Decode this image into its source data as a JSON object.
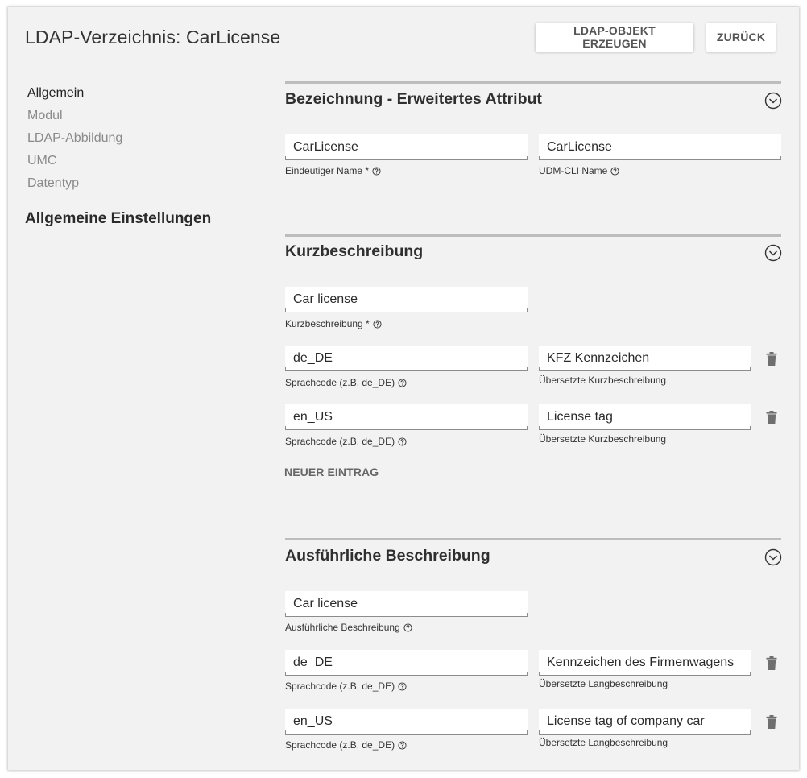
{
  "header": {
    "title": "LDAP-Verzeichnis: CarLicense",
    "create_label": "LDAP-OBJEKT ERZEUGEN",
    "back_label": "ZURÜCK"
  },
  "sidebar": {
    "items": [
      {
        "label": "Allgemein",
        "active": true
      },
      {
        "label": "Modul"
      },
      {
        "label": "LDAP-Abbildung"
      },
      {
        "label": "UMC"
      },
      {
        "label": "Datentyp"
      }
    ],
    "heading": "Allgemeine Einstellungen"
  },
  "sections": {
    "bezeichnung": {
      "title": "Bezeichnung - Erweitertes Attribut",
      "unique_name": {
        "value": "CarLicense",
        "label": "Eindeutiger Name *"
      },
      "cli_name": {
        "value": "CarLicense",
        "label": "UDM-CLI Name"
      }
    },
    "kurz": {
      "title": "Kurzbeschreibung",
      "main": {
        "value": "Car license",
        "label": "Kurzbeschreibung *"
      },
      "rows": [
        {
          "code": "de_DE",
          "code_label": "Sprachcode (z.B. de_DE)",
          "text": "KFZ Kennzeichen",
          "text_label": "Übersetzte Kurzbeschreibung"
        },
        {
          "code": "en_US",
          "code_label": "Sprachcode (z.B. de_DE)",
          "text": "License tag",
          "text_label": "Übersetzte Kurzbeschreibung"
        }
      ],
      "new_entry": "NEUER EINTRAG"
    },
    "lang": {
      "title": "Ausführliche Beschreibung",
      "main": {
        "value": "Car license",
        "label": "Ausführliche Beschreibung"
      },
      "rows": [
        {
          "code": "de_DE",
          "code_label": "Sprachcode (z.B. de_DE)",
          "text": "Kennzeichen des Firmenwagens",
          "text_label": "Übersetzte Langbeschreibung"
        },
        {
          "code": "en_US",
          "code_label": "Sprachcode (z.B. de_DE)",
          "text": "License tag of company car",
          "text_label": "Übersetzte Langbeschreibung"
        }
      ]
    }
  },
  "icons": {
    "collapse": "chevron-circle-icon",
    "help": "help-circle-icon",
    "delete": "trash-icon"
  },
  "colors": {
    "background": "#f2f2f2",
    "field": "#ffffff",
    "rule": "#bdbdbd",
    "muted_text": "#8a8a8a"
  }
}
